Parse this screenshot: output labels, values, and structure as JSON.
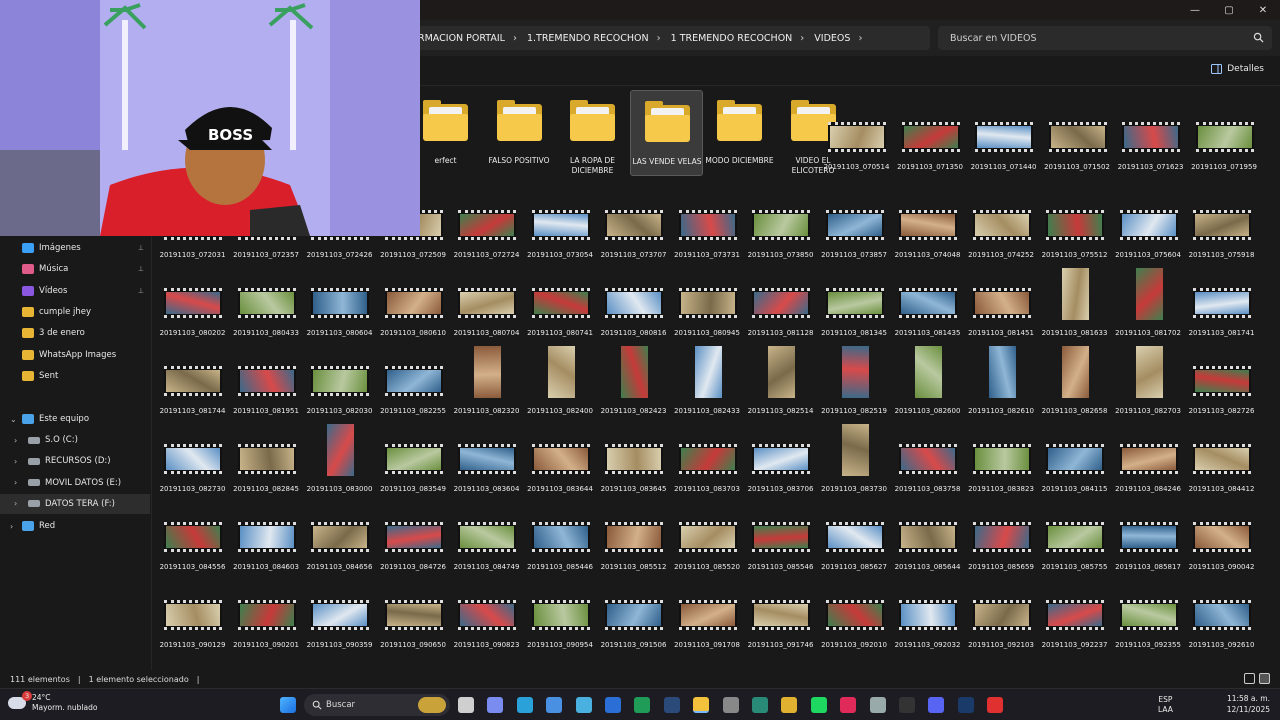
{
  "window": {
    "min": "—",
    "max": "▢",
    "close": "✕"
  },
  "breadcrumb": [
    "RMACION PORTAIL",
    "1.TREMENDO RECOCHON",
    "1 TREMENDO RECOCHON",
    "VIDEOS"
  ],
  "search": {
    "placeholder": "Buscar en VIDEOS"
  },
  "toolbar": {
    "details": "Detalles"
  },
  "sidebar": {
    "quick": [
      {
        "label": "Imágenes",
        "color": "#3aa0f5",
        "pinned": true
      },
      {
        "label": "Música",
        "color": "#e05a8a",
        "pinned": true
      },
      {
        "label": "Vídeos",
        "color": "#8a58e0",
        "pinned": true
      },
      {
        "label": "cumple jhey",
        "color": "#e8b634",
        "pinned": false
      },
      {
        "label": "3 de  enero",
        "color": "#e8b634",
        "pinned": false
      },
      {
        "label": "WhatsApp Images",
        "color": "#e8b634",
        "pinned": false
      },
      {
        "label": "Sent",
        "color": "#e8b634",
        "pinned": false
      }
    ],
    "this_pc": "Este equipo",
    "drives": [
      {
        "label": "S.O (C:)",
        "selected": false
      },
      {
        "label": "RECURSOS (D:)",
        "selected": false
      },
      {
        "label": "MOVIL DATOS (E:)",
        "selected": false
      },
      {
        "label": "DATOS TERA (F:)",
        "selected": true
      }
    ],
    "network": "Red"
  },
  "folders": [
    {
      "name": "erfect",
      "selected": false
    },
    {
      "name": "FALSO POSITIVO",
      "selected": false
    },
    {
      "name": "LA ROPA DE DICIEMBRE",
      "selected": false
    },
    {
      "name": "LAS VENDE VELAS",
      "selected": true
    },
    {
      "name": "MODO DICIEMBRE",
      "selected": false
    },
    {
      "name": "VIDEO EL ELICOTERO",
      "selected": false
    }
  ],
  "videos_row1": [
    "20191103_070514",
    "20191103_071350",
    "20191103_071440",
    "20191103_071502",
    "20191103_071623",
    "20191103_071959"
  ],
  "videos_rows": [
    [
      "20191103_072031",
      "20191103_072357",
      "20191103_072426",
      "20191103_072509",
      "20191103_072724",
      "20191103_073054",
      "20191103_073707",
      "20191103_073731",
      "20191103_073850",
      "20191103_073857",
      "20191103_074048",
      "20191103_074252",
      "20191103_075512",
      "20191103_075604",
      "20191103_075918"
    ],
    [
      "20191103_080202",
      "20191103_080433",
      "20191103_080604",
      "20191103_080610",
      "20191103_080704",
      "20191103_080741",
      "20191103_080816",
      "20191103_080945",
      "20191103_081128",
      "20191103_081345",
      "20191103_081435",
      "20191103_081451",
      "20191103_081633",
      "20191103_081702",
      "20191103_081741"
    ],
    [
      "20191103_081744",
      "20191103_081951",
      "20191103_082030",
      "20191103_082255",
      "20191103_082320",
      "20191103_082400",
      "20191103_082423",
      "20191103_082433",
      "20191103_082514",
      "20191103_082519",
      "20191103_082600",
      "20191103_082610",
      "20191103_082658",
      "20191103_082703",
      "20191103_082726"
    ],
    [
      "20191103_082730",
      "20191103_082845",
      "20191103_083000",
      "20191103_083549",
      "20191103_083604",
      "20191103_083644",
      "20191103_083645",
      "20191103_083703",
      "20191103_083706",
      "20191103_083730",
      "20191103_083758",
      "20191103_083823",
      "20191103_084115",
      "20191103_084246",
      "20191103_084412"
    ],
    [
      "20191103_084556",
      "20191103_084603",
      "20191103_084656",
      "20191103_084726",
      "20191103_084749",
      "20191103_085446",
      "20191103_085512",
      "20191103_085520",
      "20191103_085546",
      "20191103_085627",
      "20191103_085644",
      "20191103_085659",
      "20191103_085755",
      "20191103_085817",
      "20191103_090042"
    ],
    [
      "20191103_090129",
      "20191103_090201",
      "20191103_090359",
      "20191103_090650",
      "20191103_090823",
      "20191103_090954",
      "20191103_091506",
      "20191103_091708",
      "20191103_091746",
      "20191103_092010",
      "20191103_092032",
      "20191103_092103",
      "20191103_092237",
      "20191103_092355",
      "20191103_092610"
    ]
  ],
  "status": {
    "count": "111 elementos",
    "selected": "1 elemento seleccionado"
  },
  "taskbar": {
    "temp": "24°C",
    "weather": "Mayorm. nublado",
    "weather_badge": "3",
    "search": "Buscar",
    "lang1": "ESP",
    "lang2": "LAA",
    "time": "11:58 a. m.",
    "date": "12/11/2025"
  },
  "webcam": {
    "cap_text": "BOSS"
  }
}
